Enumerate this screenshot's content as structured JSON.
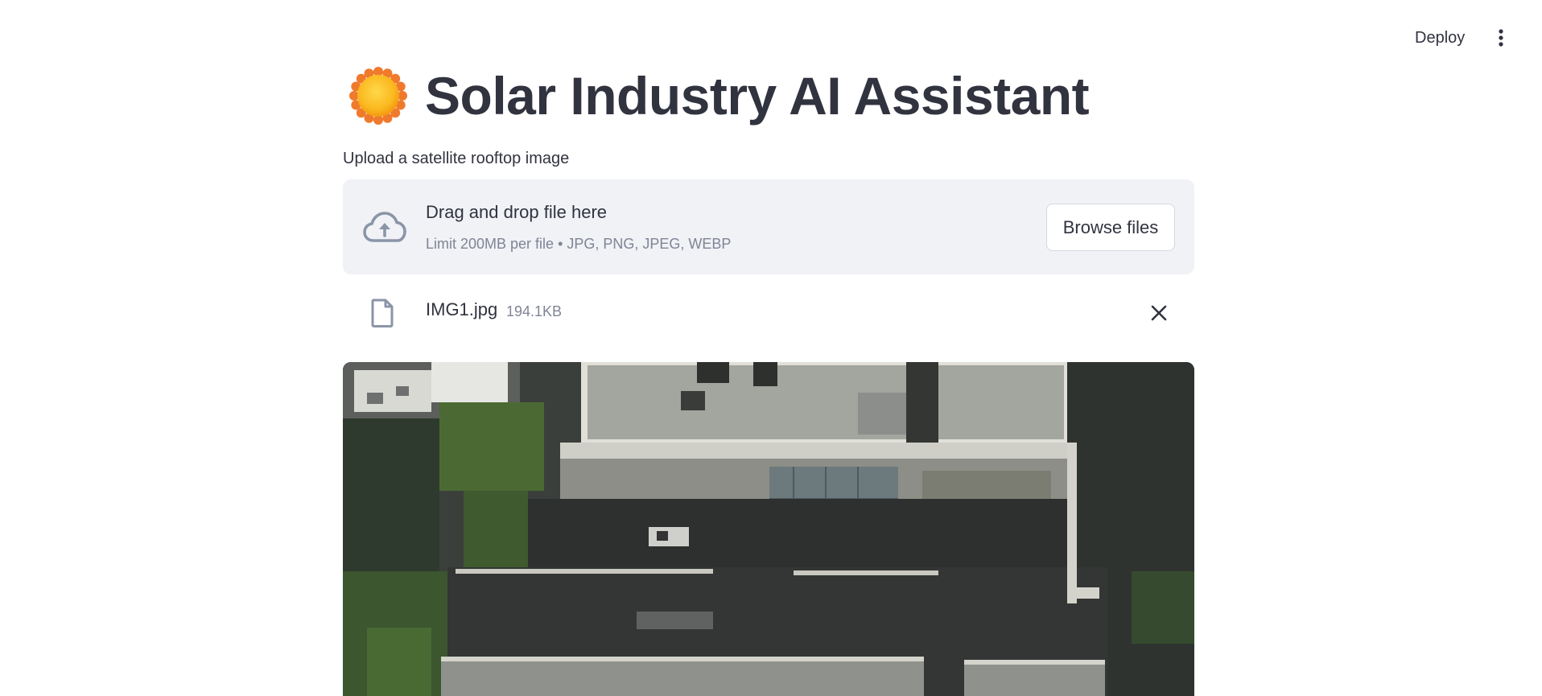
{
  "header": {
    "deploy_label": "Deploy",
    "menu_icon": "vertical-dots-icon"
  },
  "main": {
    "title_icon": "sun-icon",
    "title": "Solar Industry AI Assistant",
    "uploader": {
      "label": "Upload a satellite rooftop image",
      "drop_text": "Drag and drop file here",
      "limit_text": "Limit 200MB per file • JPG, PNG, JPEG, WEBP",
      "browse_label": "Browse files",
      "upload_icon": "cloud-upload-icon"
    },
    "uploaded_file": {
      "name": "IMG1.jpg",
      "size": "194.1KB",
      "file_icon": "file-icon",
      "remove_icon": "close-icon"
    },
    "preview_image": {
      "description_icon": "satellite-rooftop-image"
    }
  },
  "colors": {
    "text": "#31333f",
    "muted": "#808495",
    "dropzone_bg": "#f0f2f6",
    "icon_gray": "#8b95a8"
  }
}
